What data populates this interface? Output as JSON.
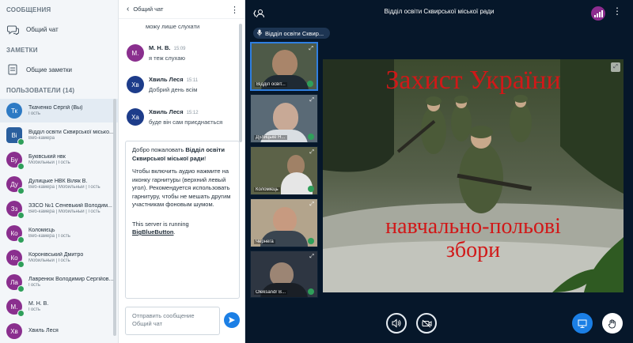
{
  "sidebar": {
    "messages_title": "СООБЩЕНИЯ",
    "public_chat": "Общий чат",
    "notes_title": "ЗАМЕТКИ",
    "shared_notes": "Общие заметки",
    "users_title": "ПОЛЬЗОВАТЕЛИ (14)",
    "users": [
      {
        "initials": "Тк",
        "name": "Ткаченко Сергій (Вы)",
        "role": "Гость",
        "color": "#2d7ac4"
      },
      {
        "initials": "Ві",
        "name": "Відділ освіти Сквирської місько...",
        "role": "Веб-камера",
        "color": "#2a5f9e"
      },
      {
        "initials": "Бу",
        "name": "Буківський нвк",
        "role": "Мобильный | Гость",
        "color": "#8a2f8e"
      },
      {
        "initials": "Ду",
        "name": "Дулицьке НВК Віляк В.",
        "role": "Веб-камера | Мобильный | Гость",
        "color": "#8a2f8e"
      },
      {
        "initials": "Зз",
        "name": "ЗЗСО №1 Сеневький Володим...",
        "role": "Веб-камера | Мобильный | Гость",
        "color": "#8a2f8e"
      },
      {
        "initials": "Ко",
        "name": "Коломієць",
        "role": "Веб-камера | Гость",
        "color": "#8a2f8e"
      },
      {
        "initials": "Ко",
        "name": "Коронівський Дмитро",
        "role": "Мобильный | Гость",
        "color": "#8a2f8e"
      },
      {
        "initials": "Ла",
        "name": "Лавренюк Володимир Сергійов...",
        "role": "Гость",
        "color": "#8a2f8e"
      },
      {
        "initials": "М.",
        "name": "М. Н. В.",
        "role": "Гость",
        "color": "#8a2f8e"
      },
      {
        "initials": "Хв",
        "name": "Хвиль Леся",
        "role": "",
        "color": "#8a2f8e"
      }
    ]
  },
  "chat": {
    "title": "Общий чат",
    "prev_text": "можу лише слухати",
    "messages": [
      {
        "initials": "М.",
        "name": "М. Н. В.",
        "time": "15:09",
        "text": "я теж слухаю",
        "color": "#8a2f8e"
      },
      {
        "initials": "Хв",
        "name": "Хвиль Леся",
        "time": "15:11",
        "text": "Добрий день всім",
        "color": "#1d3c8a"
      },
      {
        "initials": "Ха",
        "name": "Хвиль Леся",
        "time": "15:12",
        "text": "буде він сам приєднається",
        "color": "#1d3c8a"
      }
    ],
    "welcome_prefix": "Добро пожаловать ",
    "welcome_name": "Відділ освіти Сквирської міської ради",
    "welcome_suffix": "!",
    "welcome_body": "Чтобы включить аудио нажмите на иконку гарнитуры (верхний левый угол). Рекомендуется использовать гарнитуру, чтобы не мешать другим участникам фоновым шумом.",
    "server_text": "This server is running ",
    "server_link": "BigBlueButton",
    "server_end": ".",
    "input_placeholder": "Отправить сообщение Общий чат"
  },
  "main": {
    "title": "Відділ освіти Сквирської міської ради",
    "presenter": "Відділ освіти Сквир...",
    "videos": [
      {
        "name": "Відділ освіт..."
      },
      {
        "name": "Дулицьке Н..."
      },
      {
        "name": "Коломієць"
      },
      {
        "name": "Чернега"
      },
      {
        "name": "Oleksandr B..."
      }
    ],
    "slide": {
      "title": "Захист України",
      "sub1": "навчально-польові",
      "sub2": "збори"
    }
  }
}
